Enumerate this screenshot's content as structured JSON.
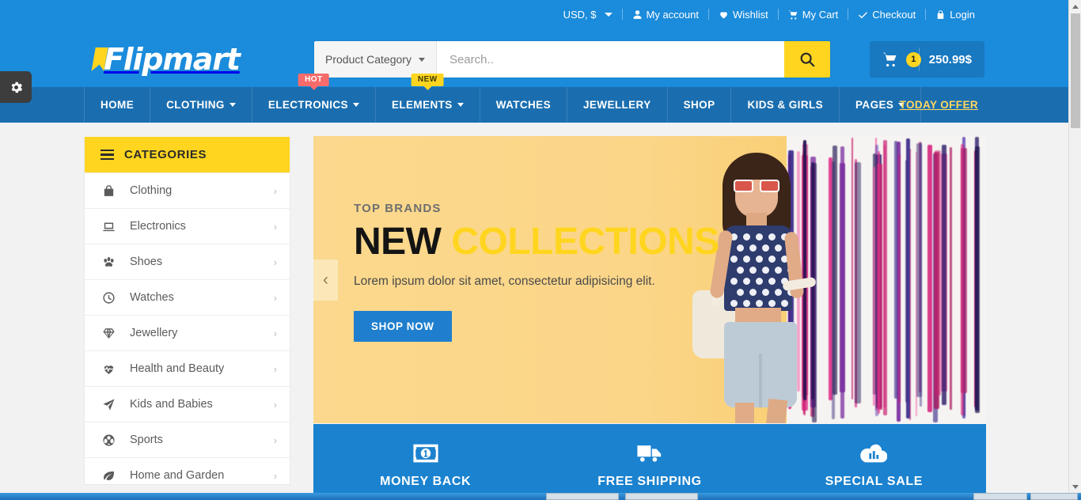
{
  "topbar": {
    "currency": "USD, $",
    "links": [
      {
        "label": "My account",
        "icon": "user-icon"
      },
      {
        "label": "Wishlist",
        "icon": "heart-icon"
      },
      {
        "label": "My Cart",
        "icon": "cart-icon"
      },
      {
        "label": "Checkout",
        "icon": "check-icon"
      },
      {
        "label": "Login",
        "icon": "lock-icon"
      }
    ]
  },
  "brand": {
    "name": "Flipmart"
  },
  "search": {
    "category_label": "Product Category",
    "placeholder": "Search..",
    "value": "",
    "button_icon": "search-icon"
  },
  "cart": {
    "icon": "cart-icon",
    "count": "1",
    "total": "250.99$"
  },
  "nav": {
    "items": [
      {
        "label": "HOME",
        "caret": false,
        "badge": null
      },
      {
        "label": "CLOTHING",
        "caret": true,
        "badge": null
      },
      {
        "label": "ELECTRONICS",
        "caret": true,
        "badge": "HOT"
      },
      {
        "label": "ELEMENTS",
        "caret": true,
        "badge": "NEW"
      },
      {
        "label": "WATCHES",
        "caret": false,
        "badge": null
      },
      {
        "label": "JEWELLERY",
        "caret": false,
        "badge": null
      },
      {
        "label": "SHOP",
        "caret": false,
        "badge": null
      },
      {
        "label": "KIDS & GIRLS",
        "caret": false,
        "badge": null
      },
      {
        "label": "PAGES",
        "caret": true,
        "badge": null
      }
    ],
    "today_offer": "TODAY OFFER"
  },
  "sidebar": {
    "header": "CATEGORIES",
    "header_icon": "hamburger-icon",
    "items": [
      {
        "label": "Clothing",
        "icon": "bag-icon",
        "arrow": "›"
      },
      {
        "label": "Electronics",
        "icon": "laptop-icon",
        "arrow": "›"
      },
      {
        "label": "Shoes",
        "icon": "paw-icon",
        "arrow": "›"
      },
      {
        "label": "Watches",
        "icon": "clock-icon",
        "arrow": "›"
      },
      {
        "label": "Jewellery",
        "icon": "diamond-icon",
        "arrow": "›"
      },
      {
        "label": "Health and Beauty",
        "icon": "heartbeat-icon",
        "arrow": "›"
      },
      {
        "label": "Kids and Babies",
        "icon": "paper-plane-icon",
        "arrow": "›"
      },
      {
        "label": "Sports",
        "icon": "soccer-ball-icon",
        "arrow": "›"
      },
      {
        "label": "Home and Garden",
        "icon": "leaf-icon",
        "arrow": "›"
      }
    ]
  },
  "hero": {
    "kicker": "TOP BRANDS",
    "title_dark": "NEW",
    "title_accent": "COLLECTIONS",
    "subtitle": "Lorem ipsum dolor sit amet, consectetur adipisicing elit.",
    "cta": "SHOP NOW",
    "prev_arrow": "‹"
  },
  "features": [
    {
      "label": "MONEY BACK",
      "icon": "money-bill-icon"
    },
    {
      "label": "FREE SHIPPING",
      "icon": "truck-icon"
    },
    {
      "label": "SPECIAL SALE",
      "icon": "bar-chart-icon"
    }
  ],
  "settings_tab": {
    "icon": "gear-icon"
  },
  "colors": {
    "header_blue": "#1b8bdb",
    "nav_blue": "#1a6eb0",
    "accent_yellow": "#ffd520",
    "hot_red": "#f76b6b",
    "hero_bg": "#fbd88d",
    "button_blue": "#1f7fce"
  }
}
